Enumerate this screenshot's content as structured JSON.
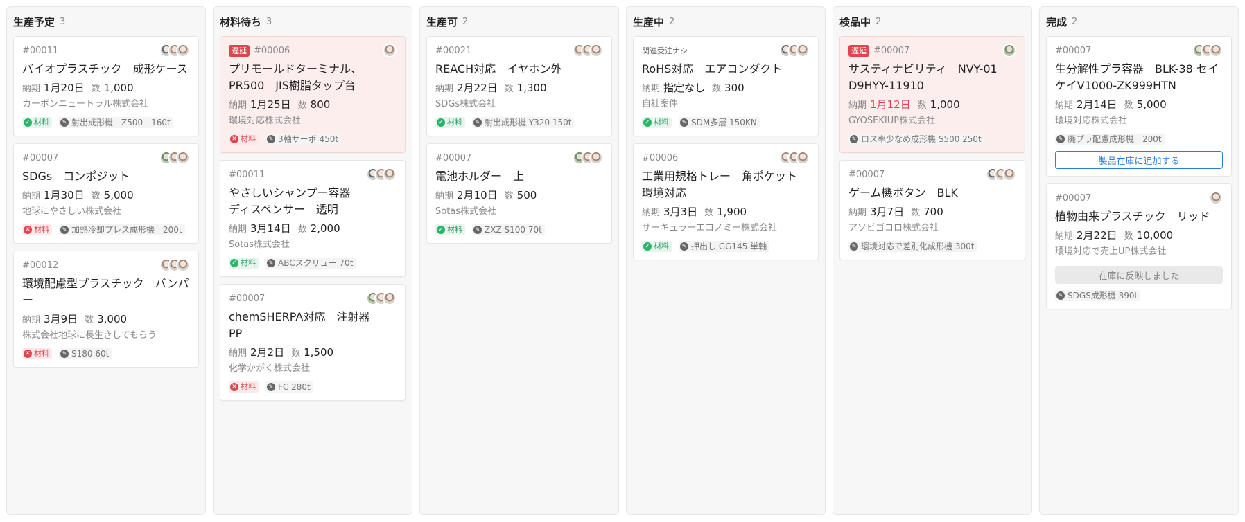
{
  "labels": {
    "due": "納期",
    "qty": "数",
    "material": "材料",
    "late": "遅延"
  },
  "colors": {
    "accent": "#2c7be5",
    "late": "#e0454f",
    "ok": "#2db46a"
  },
  "columns": [
    {
      "title": "生産予定",
      "count": "3",
      "cards": [
        {
          "id": "#00011",
          "title": "バイオプラスチック　成形ケース",
          "due": "1月20日",
          "qty": "1,000",
          "company": "カーボンニュートラル株式会社",
          "material_ok": true,
          "machine": "射出成形機　Z500　160t"
        },
        {
          "id": "#00007",
          "title": "SDGs　コンポジット",
          "due": "1月30日",
          "qty": "5,000",
          "company": "地球にやさしい株式会社",
          "material_ok": false,
          "machine": "加熱冷却プレス成形機　200t"
        },
        {
          "id": "#00012",
          "title": "環境配慮型プラスチック　バンパー",
          "due": "3月9日",
          "qty": "3,000",
          "company": "株式会社地球に長生きしてもらう",
          "material_ok": false,
          "machine": "S180 60t"
        }
      ]
    },
    {
      "title": "材料待ち",
      "count": "3",
      "cards": [
        {
          "id": "#00006",
          "late": true,
          "title": "プリモールドターミナル、\nPR500　JIS樹脂タップ台",
          "due": "1月25日",
          "qty": "800",
          "company": "環境対応株式会社",
          "material_ok": false,
          "machine": "3軸サーボ 450t"
        },
        {
          "id": "#00011",
          "title": "やさしいシャンプー容器\nディスペンサー　透明",
          "due": "3月14日",
          "qty": "2,000",
          "company": "Sotas株式会社",
          "material_ok": true,
          "machine": "ABCスクリュー 70t"
        },
        {
          "id": "#00007",
          "title": "chemSHERPA対応　注射器\nPP",
          "due": "2月2日",
          "qty": "1,500",
          "company": "化学かがく株式会社",
          "material_ok": false,
          "machine": "FC 280t"
        }
      ]
    },
    {
      "title": "生産可",
      "count": "2",
      "cards": [
        {
          "id": "#00021",
          "title": "REACH対応　イヤホン外",
          "due": "2月22日",
          "qty": "1,300",
          "company": "SDGs株式会社",
          "material_ok": true,
          "machine": "射出成形機 Y320 150t"
        },
        {
          "id": "#00007",
          "title": "電池ホルダー　上",
          "due": "2月10日",
          "qty": "500",
          "company": "Sotas株式会社",
          "material_ok": true,
          "machine": "ZXZ S100 70t"
        }
      ]
    },
    {
      "title": "生産中",
      "count": "2",
      "cards": [
        {
          "related": "関連受注ナシ",
          "title": "RoHS対応　エアコンダクト",
          "due": "指定なし",
          "qty": "300",
          "company": "自社案件",
          "material_ok": true,
          "machine": "SDM多層 150KN"
        },
        {
          "id": "#00006",
          "title": "工業用規格トレー　角ポケット\n環境対応",
          "due": "3月3日",
          "qty": "1,900",
          "company": "サーキュラーエコノミー株式会社",
          "material_ok": true,
          "machine": "押出し GG145 単軸"
        }
      ]
    },
    {
      "title": "検品中",
      "count": "2",
      "cards": [
        {
          "id": "#00007",
          "late": true,
          "title": "サスティナビリティ　NVY-01\nD9HYY-11910",
          "due": "1月12日",
          "due_red": true,
          "qty": "1,000",
          "company": "GYOSEKIUP株式会社",
          "machine": "ロス率少なめ成形機 S500 250t"
        },
        {
          "id": "#00007",
          "title": "ゲーム機ボタン　BLK",
          "due": "3月7日",
          "qty": "700",
          "company": "アソビゴコロ株式会社",
          "machine": "環境対応で差別化成形機 300t"
        }
      ]
    },
    {
      "title": "完成",
      "count": "2",
      "cards": [
        {
          "id": "#00007",
          "title": "生分解性プラ容器　BLK-38 セイ\nケイV1000-ZK999HTN",
          "due": "2月14日",
          "qty": "5,000",
          "company": "環境対応株式会社",
          "machine": "廃プラ配慮成形機　200t",
          "button": "製品在庫に追加する"
        },
        {
          "id": "#00007",
          "title": "植物由来プラスチック　リッド",
          "due": "2月22日",
          "qty": "10,000",
          "company": "環境対応で売上UP株式会社",
          "status_button": "在庫に反映しました",
          "machine": "SDGS成形機 390t"
        }
      ]
    }
  ]
}
